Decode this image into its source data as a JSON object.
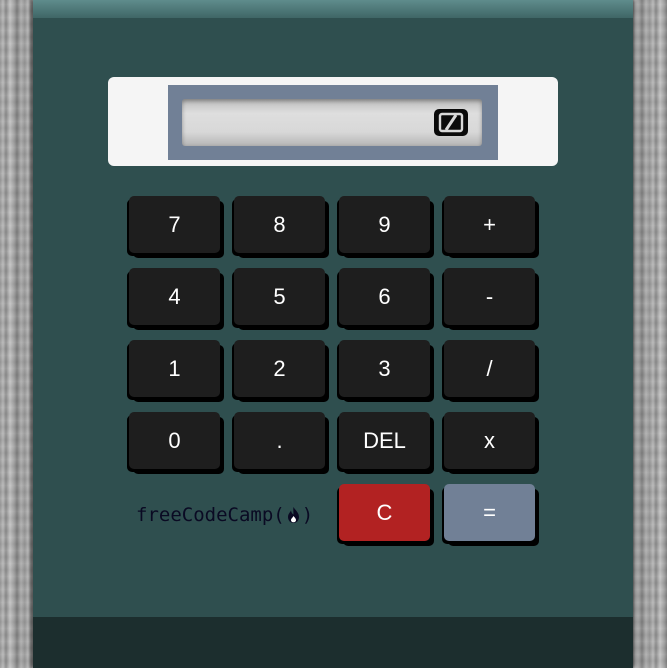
{
  "display": {
    "value": ""
  },
  "keys": {
    "r1": [
      "7",
      "8",
      "9",
      "+"
    ],
    "r2": [
      "4",
      "5",
      "6",
      "-"
    ],
    "r3": [
      "1",
      "2",
      "3",
      "/"
    ],
    "r4": [
      "0",
      ".",
      "DEL",
      "x"
    ],
    "clear": "C",
    "equals": "="
  },
  "brand": {
    "text_before": "freeCodeCamp(",
    "text_after": ")",
    "icon": "flame-icon"
  },
  "colors": {
    "body": "#2f4f4f",
    "key": "#1e1e1e",
    "clear_key": "#b22222",
    "equals_key": "#718096",
    "screen_frame": "#718096"
  }
}
